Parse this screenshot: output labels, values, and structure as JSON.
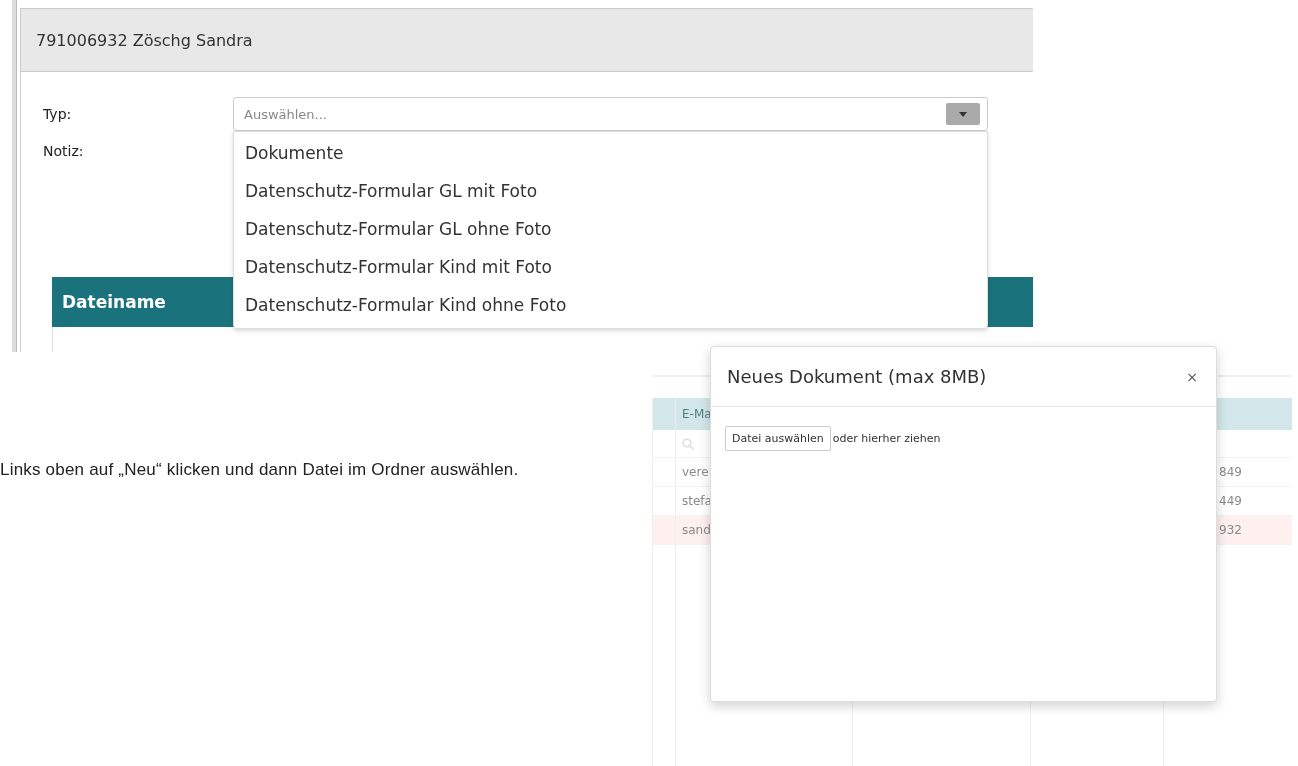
{
  "screenshot_top": {
    "title": "791006932 Zöschg Sandra",
    "fields": [
      {
        "label": "Typ:"
      },
      {
        "label": "Notiz:"
      }
    ],
    "select": {
      "placeholder": "Auswählen...",
      "expanded": true,
      "options": [
        {
          "label": "Dokumente"
        },
        {
          "label": "Datenschutz-Formular GL mit Foto"
        },
        {
          "label": "Datenschutz-Formular GL ohne Foto"
        },
        {
          "label": "Datenschutz-Formular Kind mit Foto"
        },
        {
          "label": "Datenschutz-Formular Kind ohne Foto"
        }
      ]
    },
    "table": {
      "columns": [
        "Dateiname"
      ]
    }
  },
  "instruction": "Links oben auf „Neu“ klicken und dann Datei im Ordner auswählen.",
  "screenshot_bottom": {
    "background_table": {
      "columns": [
        "E-Ma"
      ],
      "rows": [
        {
          "cells": [
            "vere",
            "849"
          ],
          "selected": false
        },
        {
          "cells": [
            "stefa",
            "449"
          ],
          "selected": false
        },
        {
          "cells": [
            "sand",
            "932"
          ],
          "selected": true
        }
      ]
    },
    "dialog": {
      "title": "Neues Dokument (max 8MB)",
      "close": "×",
      "file_button": "Datei auswählen",
      "drop_hint": "oder hierher ziehen"
    }
  }
}
